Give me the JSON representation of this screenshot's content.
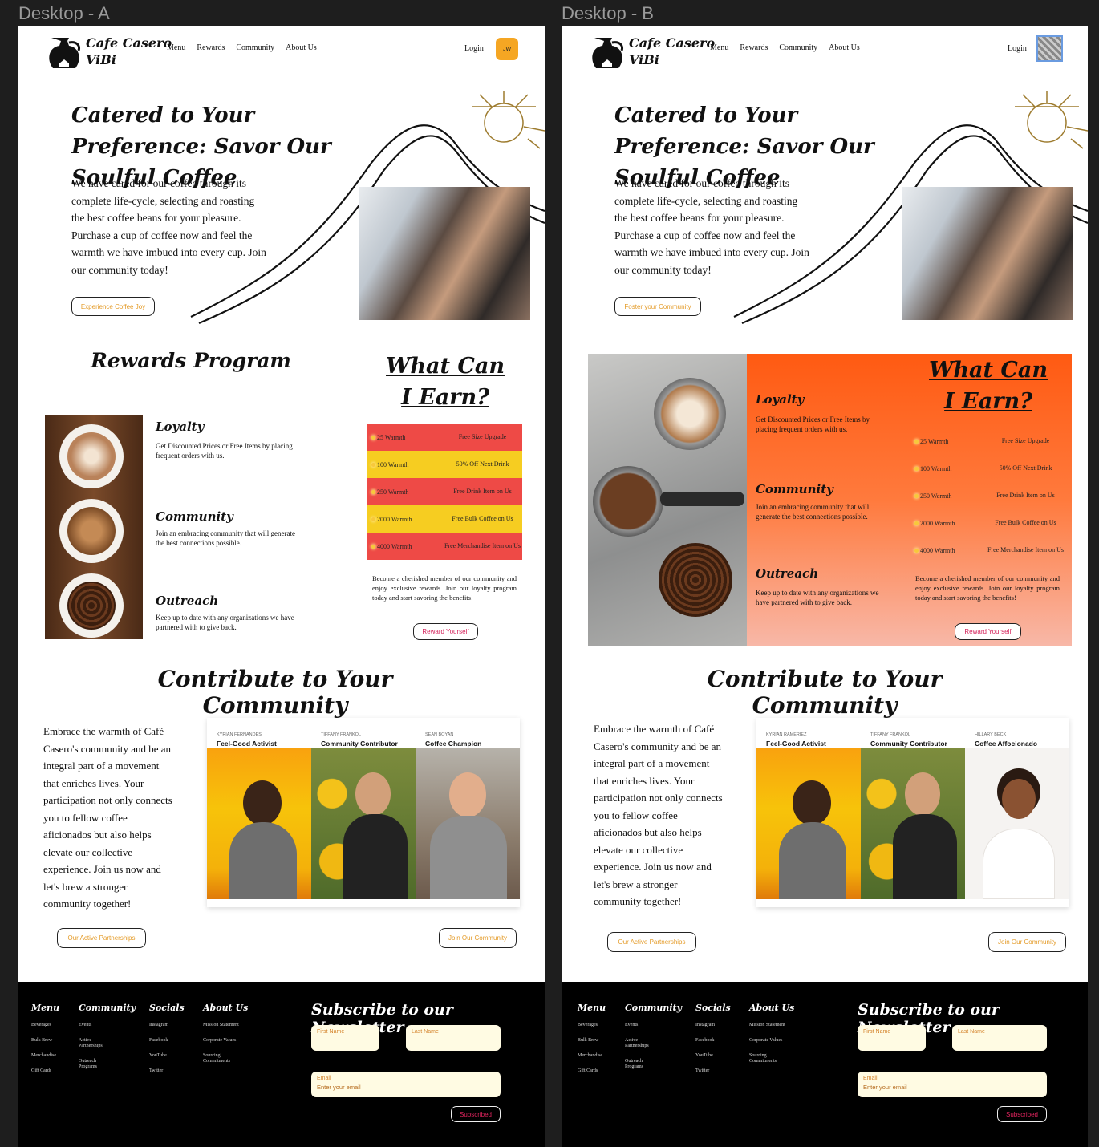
{
  "frames": {
    "a_label": "Desktop - A",
    "b_label": "Desktop - B"
  },
  "brand": {
    "name": "Cafe Casero ViBi"
  },
  "nav": {
    "links": [
      "Menu",
      "Rewards",
      "Community",
      "About Us"
    ],
    "login": "Login",
    "avatar_initials": "JW"
  },
  "hero": {
    "title": "Catered to Your Preference: Savor Our Soulful Coffee",
    "body": "We have cared for our coffee through its complete life-cycle, selecting and roasting the best coffee beans for your pleasure. Purchase a cup of coffee now and feel the warmth we have imbued into every cup. Join our community today!",
    "cta_a": "Experience Coffee Joy",
    "cta_b": "Foster your Community"
  },
  "rewards": {
    "title": "Rewards Program",
    "benefits": [
      {
        "title": "Loyalty",
        "text": "Get Discounted Prices or Free Items by placing frequent orders with us."
      },
      {
        "title": "Community",
        "text": "Join an embracing community that will generate the best connections possible."
      },
      {
        "title": "Outreach",
        "text": "Keep up to date with any organizations we have partnered with to give back."
      }
    ],
    "earn_title_1": "What Can",
    "earn_title_2": "I Earn?",
    "tiers": [
      {
        "points": "25 Warmth",
        "reward": "Free Size Upgrade",
        "color": "#ee4a46"
      },
      {
        "points": "100 Warmth",
        "reward": "50% Off Next Drink",
        "color": "#f6cd21"
      },
      {
        "points": "250 Warmth",
        "reward": "Free Drink Item on Us",
        "color": "#ee4a46"
      },
      {
        "points": "2000 Warmth",
        "reward": "Free Bulk Coffee on Us",
        "color": "#f6cd21"
      },
      {
        "points": "4000 Warmth",
        "reward": "Free Merchandise Item on Us",
        "color": "#ee4a46"
      }
    ],
    "note": "Become a cherished member of our community and enjoy exclusive rewards. Join our loyalty program today and start savoring the benefits!",
    "cta": "Reward Yourself"
  },
  "community": {
    "title": "Contribute to Your Community",
    "body": "Embrace the warmth of Café Casero's community and be an integral part of a movement that enriches lives. Your participation not only connects you to fellow coffee aficionados but also helps elevate our collective experience. Join us now and let's brew a stronger community together!",
    "cards_a": [
      {
        "name": "Kyrian Fernandes",
        "role": "Feel-Good Activist"
      },
      {
        "name": "Tiffany Frankol",
        "role": "Community Contributor"
      },
      {
        "name": "Sean Boyan",
        "role": "Coffee Champion"
      }
    ],
    "cards_b": [
      {
        "name": "Kyrian Rameriez",
        "role": "Feel-Good Activist"
      },
      {
        "name": "Tiffany Frankol",
        "role": "Community Contributor"
      },
      {
        "name": "Hillary Beck",
        "role": "Coffee Affocionado"
      }
    ],
    "cta_partnerships": "Our Active Partnerships",
    "cta_join": "Join Our Community"
  },
  "footer": {
    "columns": [
      {
        "title": "Menu",
        "items": [
          "Beverages",
          "Bulk Brew",
          "Merchandise",
          "Gift Cards"
        ]
      },
      {
        "title": "Community",
        "items": [
          "Events",
          "Active Partnerships",
          "Outreach Programs"
        ]
      },
      {
        "title": "Socials",
        "items": [
          "Instagram",
          "Facebook",
          "YouTube",
          "Twitter"
        ]
      },
      {
        "title": "About Us",
        "items": [
          "Mission Statement",
          "Corporate Values",
          "Sourcing Commitments"
        ]
      }
    ],
    "newsletter_title": "Subscribe to our Newsletter",
    "first_name_label": "First Name",
    "last_name_label": "Last Name",
    "email_label": "Email",
    "email_placeholder": "Enter your email",
    "subscribe": "Subscribed"
  }
}
